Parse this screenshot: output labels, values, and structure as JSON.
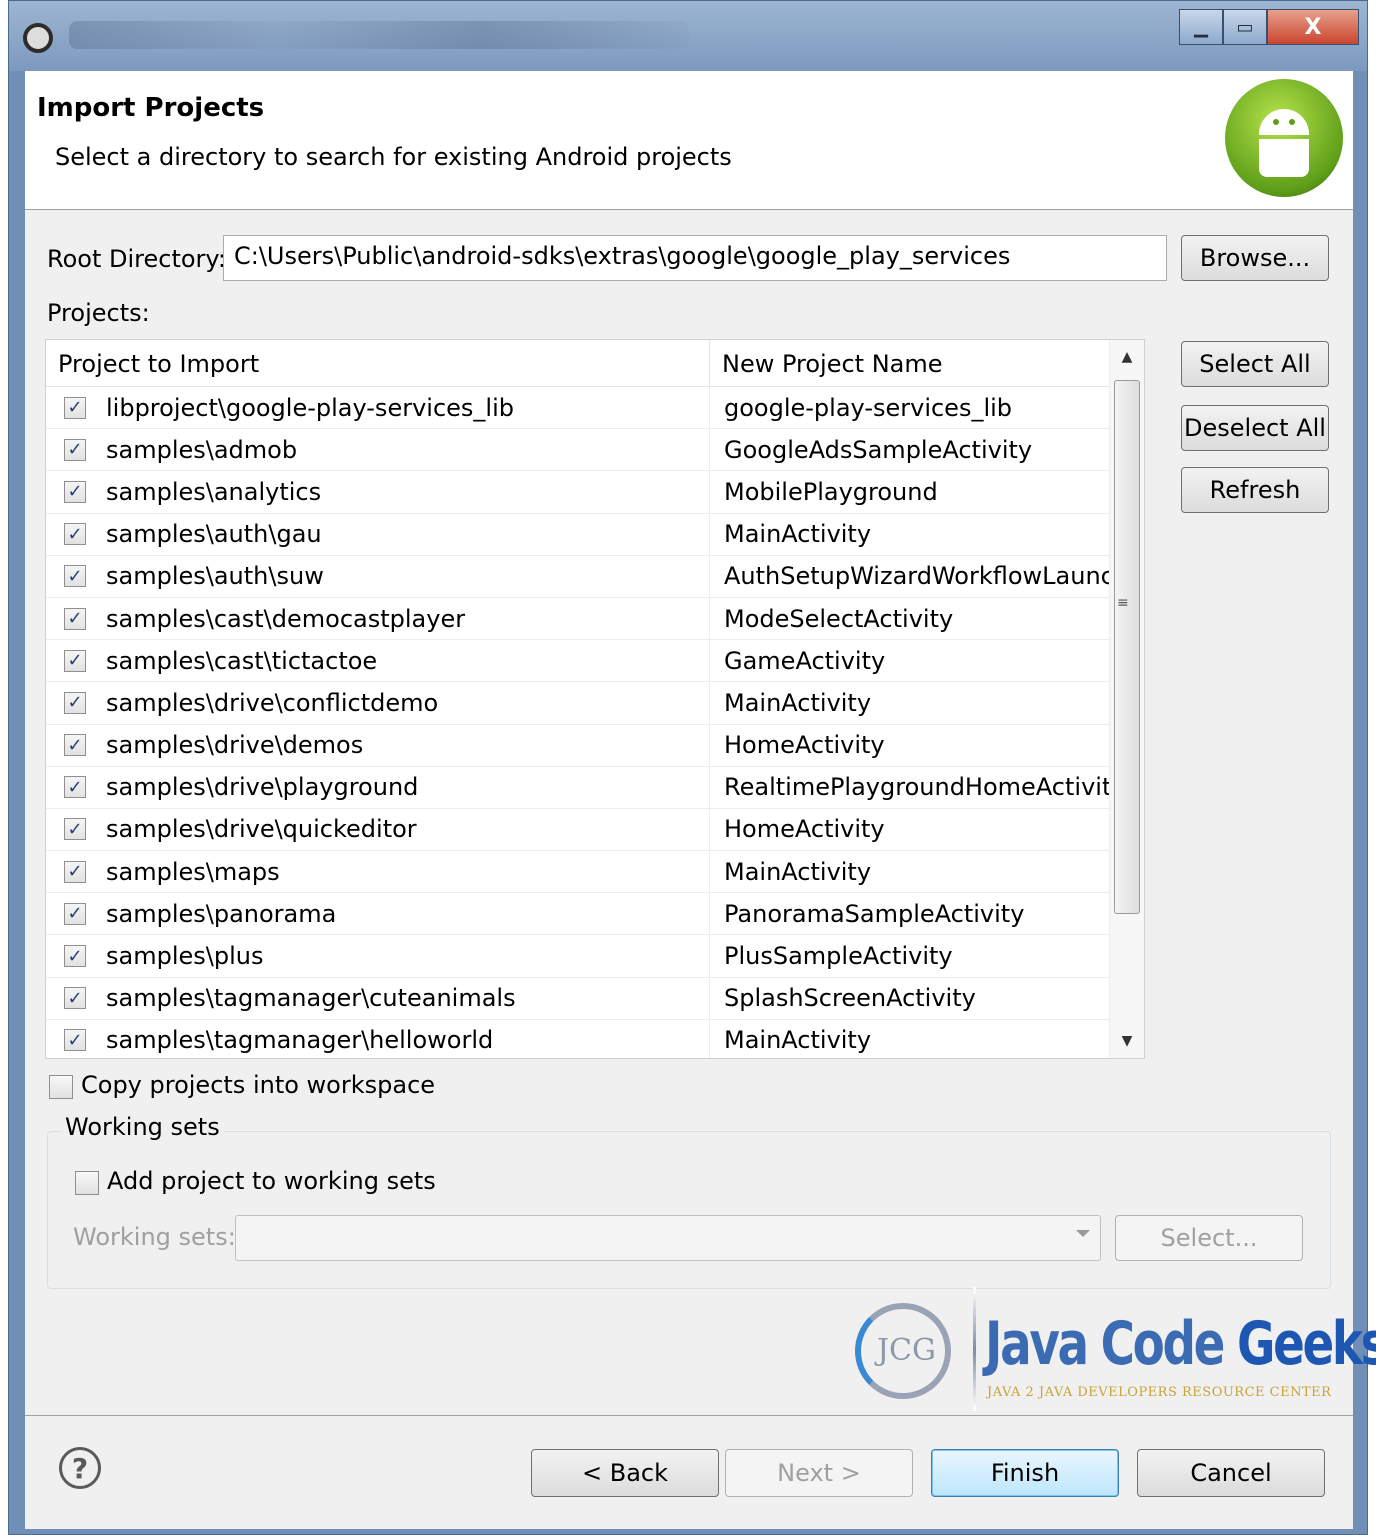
{
  "window": {
    "controls": {
      "minimize": "▁",
      "maximize": "▭",
      "close": "X"
    }
  },
  "header": {
    "title": "Import Projects",
    "subtitle": "Select a directory to search for existing Android projects",
    "logo_icon": "android-icon"
  },
  "root": {
    "label": "Root Directory:",
    "value": "C:\\Users\\Public\\android-sdks\\extras\\google\\google_play_services",
    "browse_label": "Browse..."
  },
  "projects": {
    "label": "Projects:",
    "columns": [
      "Project to Import",
      "New Project Name"
    ],
    "rows": [
      {
        "checked": true,
        "path": "libproject\\google-play-services_lib",
        "name": "google-play-services_lib"
      },
      {
        "checked": true,
        "path": "samples\\admob",
        "name": "GoogleAdsSampleActivity"
      },
      {
        "checked": true,
        "path": "samples\\analytics",
        "name": "MobilePlayground"
      },
      {
        "checked": true,
        "path": "samples\\auth\\gau",
        "name": "MainActivity"
      },
      {
        "checked": true,
        "path": "samples\\auth\\suw",
        "name": "AuthSetupWizardWorkflowLaunc..."
      },
      {
        "checked": true,
        "path": "samples\\cast\\democastplayer",
        "name": "ModeSelectActivity"
      },
      {
        "checked": true,
        "path": "samples\\cast\\tictactoe",
        "name": "GameActivity"
      },
      {
        "checked": true,
        "path": "samples\\drive\\conflictdemo",
        "name": "MainActivity"
      },
      {
        "checked": true,
        "path": "samples\\drive\\demos",
        "name": "HomeActivity"
      },
      {
        "checked": true,
        "path": "samples\\drive\\playground",
        "name": "RealtimePlaygroundHomeActivity"
      },
      {
        "checked": true,
        "path": "samples\\drive\\quickeditor",
        "name": "HomeActivity"
      },
      {
        "checked": true,
        "path": "samples\\maps",
        "name": "MainActivity"
      },
      {
        "checked": true,
        "path": "samples\\panorama",
        "name": "PanoramaSampleActivity"
      },
      {
        "checked": true,
        "path": "samples\\plus",
        "name": "PlusSampleActivity"
      },
      {
        "checked": true,
        "path": "samples\\tagmanager\\cuteanimals",
        "name": "SplashScreenActivity"
      },
      {
        "checked": true,
        "path": "samples\\tagmanager\\helloworld",
        "name": "MainActivity"
      }
    ],
    "select_all_label": "Select All",
    "deselect_all_label": "Deselect All",
    "refresh_label": "Refresh"
  },
  "options": {
    "copy_label": "Copy projects into workspace",
    "copy_checked": false
  },
  "working_sets": {
    "group_title": "Working sets",
    "add_label": "Add project to working sets",
    "add_checked": false,
    "field_label": "Working sets:",
    "select_label": "Select..."
  },
  "watermark": {
    "monogram": "JCG",
    "brand_java": "Java Code",
    "brand_geeks": "Geeks",
    "tagline": "JAVA 2 JAVA DEVELOPERS RESOURCE CENTER"
  },
  "footer": {
    "help_icon": "help-icon",
    "back_label": "< Back",
    "next_label": "Next >",
    "finish_label": "Finish",
    "cancel_label": "Cancel"
  }
}
